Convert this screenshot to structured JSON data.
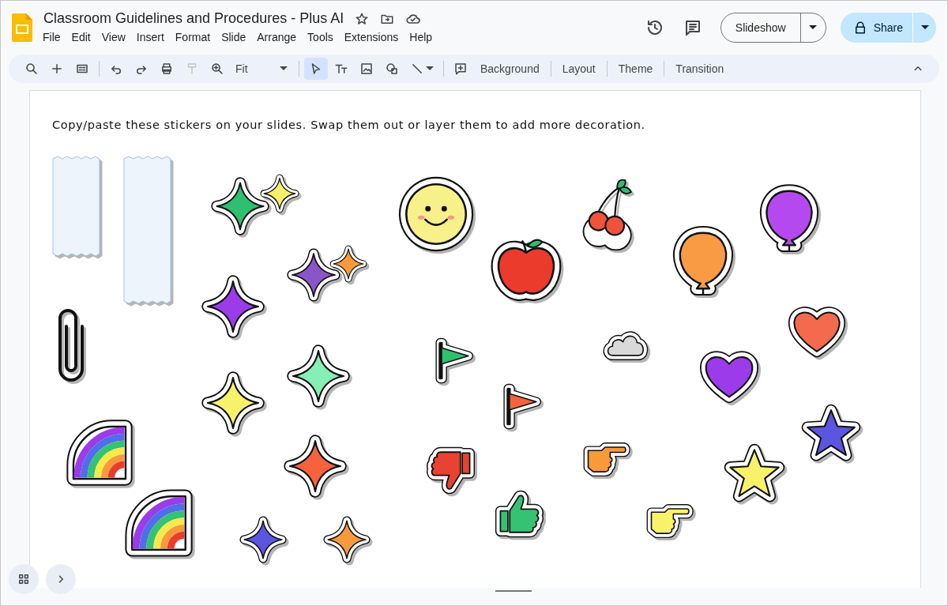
{
  "document": {
    "title": "Classroom Guidelines and Procedures - Plus AI"
  },
  "menu": [
    "File",
    "Edit",
    "View",
    "Insert",
    "Format",
    "Slide",
    "Arrange",
    "Tools",
    "Extensions",
    "Help"
  ],
  "header_buttons": {
    "slideshow": "Slideshow",
    "share": "Share"
  },
  "toolbar": {
    "tools": [
      {
        "kind": "search",
        "selected": false
      },
      {
        "kind": "add",
        "selected": false
      },
      {
        "kind": "layout",
        "selected": false
      },
      {
        "kind": "divider"
      },
      {
        "kind": "undo",
        "selected": false
      },
      {
        "kind": "redo",
        "selected": false
      },
      {
        "kind": "print",
        "selected": false
      },
      {
        "kind": "paint",
        "selected": false,
        "disabled": true
      },
      {
        "kind": "zoom",
        "selected": false
      },
      {
        "kind": "zoom-select",
        "label": "Fit"
      },
      {
        "kind": "divider"
      },
      {
        "kind": "select",
        "selected": true
      },
      {
        "kind": "text",
        "selected": false
      },
      {
        "kind": "image",
        "selected": false
      },
      {
        "kind": "shape",
        "selected": false
      },
      {
        "kind": "line",
        "selected": false
      },
      {
        "kind": "divider"
      },
      {
        "kind": "comment",
        "selected": false
      }
    ],
    "actions": [
      "Background",
      "Layout",
      "Theme",
      "Transition"
    ]
  },
  "slide": {
    "text": "Copy/paste these stickers on your slides. Swap them out or layer them to add more decoration."
  }
}
